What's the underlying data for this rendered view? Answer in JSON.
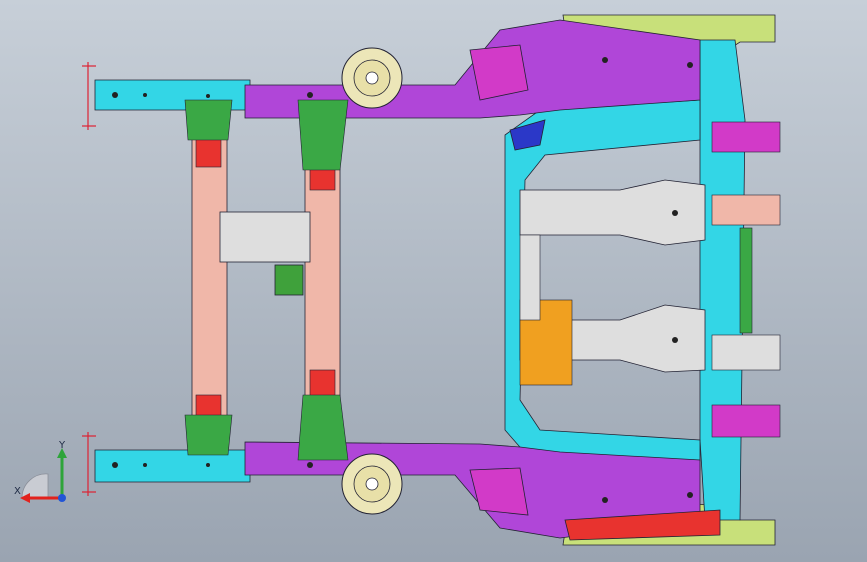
{
  "viewport": {
    "background_top": "#c7cfd8",
    "background_bottom": "#9aa4b1"
  },
  "parts": {
    "rail": "#33d6e6",
    "crossmember": "#f0b7a9",
    "red_bracket": "#e8332f",
    "green_bracket": "#3aa845",
    "purple_plate": "#b046d8",
    "magenta": "#d23ac8",
    "yellow_green": "#c8e07a",
    "silver": "#dedede",
    "orange": "#f0a020",
    "mount": "#ece6b8",
    "blue": "#2b38c8",
    "dark_green": "#3fa13b"
  },
  "triad": {
    "x_label": "X",
    "y_label": "Y",
    "x_color": "#e2221d",
    "y_color": "#2ea43a",
    "z_color": "#2255d6"
  }
}
